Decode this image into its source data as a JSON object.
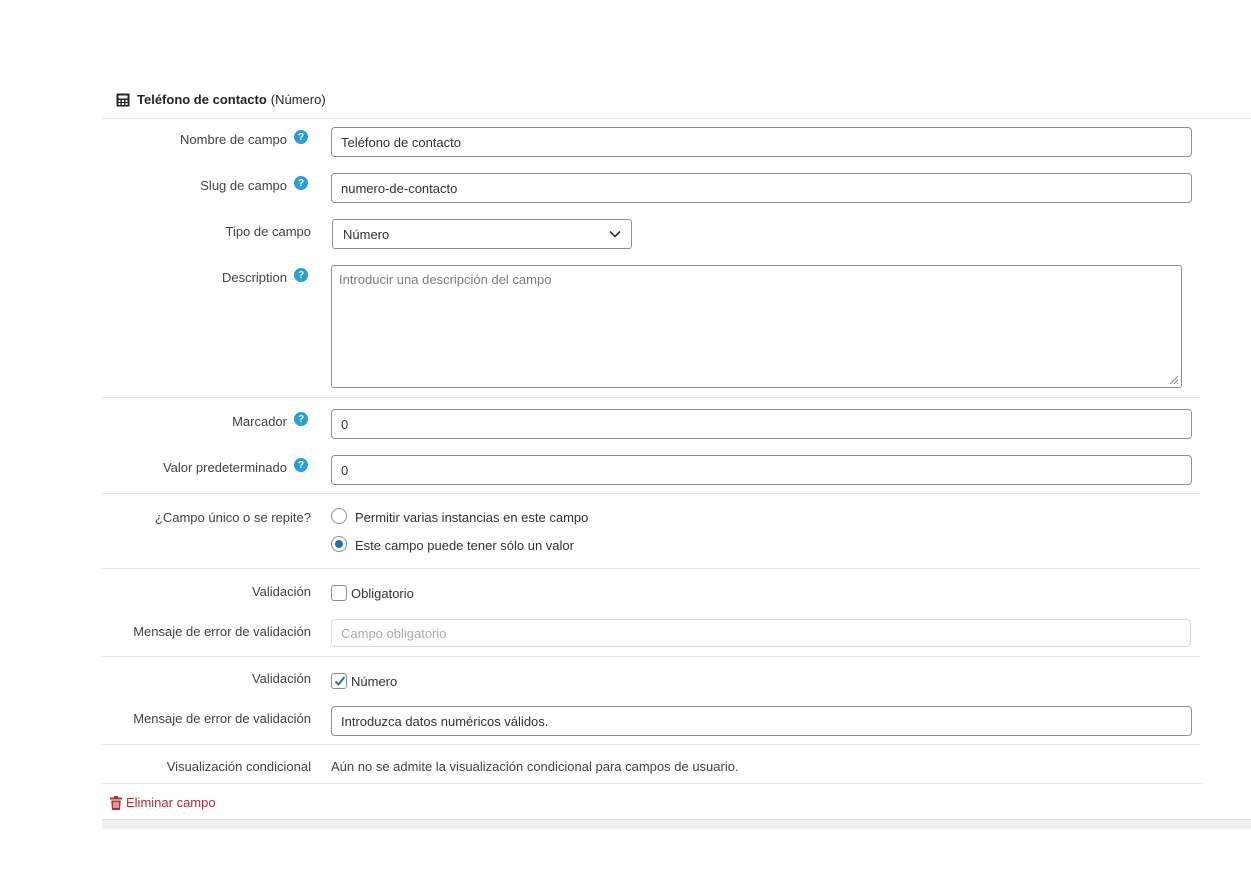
{
  "header": {
    "title": "Teléfono de contacto",
    "type": "(Número)",
    "icon": "calculator-icon"
  },
  "fields": {
    "name": {
      "label": "Nombre de campo",
      "value": "Teléfono de contacto"
    },
    "slug": {
      "label": "Slug de campo",
      "value": "numero-de-contacto"
    },
    "type": {
      "label": "Tipo de campo",
      "selected": "Número"
    },
    "description": {
      "label": "Description",
      "placeholder": "Introducir una descripción del campo"
    },
    "marker": {
      "label": "Marcador",
      "value": "0"
    },
    "default": {
      "label": "Valor predeterminado",
      "value": "0"
    },
    "repeat": {
      "label": "¿Campo único o se repite?",
      "options": [
        "Permitir varias instancias en este campo",
        "Este campo puede tener sólo un valor"
      ],
      "selected_index": 1
    },
    "validation_required": {
      "label": "Validación",
      "checkbox_label": "Obligatorio",
      "checked": false,
      "error_label": "Mensaje de error de validación",
      "error_placeholder": "Campo obligatorio"
    },
    "validation_number": {
      "label": "Validación",
      "checkbox_label": "Número",
      "checked": true,
      "error_label": "Mensaje de error de validación",
      "error_value": "Introduzca datos numéricos válidos."
    },
    "conditional": {
      "label": "Visualización condicional",
      "text": "Aún no se admite la visualización condicional para campos de usuario."
    }
  },
  "delete_label": "Eliminar campo",
  "colors": {
    "accent": "#2271b1",
    "help": "#2a9fd6",
    "danger": "#b32d2e"
  }
}
